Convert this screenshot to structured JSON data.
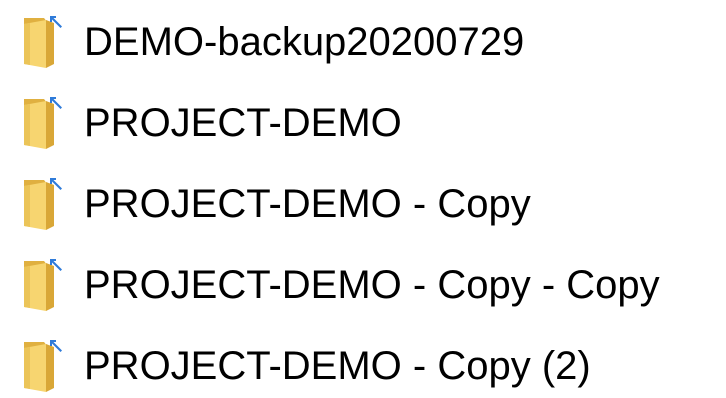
{
  "colors": {
    "folder_back": "#E0B040",
    "folder_front": "#F7D570",
    "folder_front_shade": "#EBC458",
    "shortcut_arrow": "#2F7BD9",
    "text": "#000000"
  },
  "icons": {
    "folder": "folder-shortcut-icon"
  },
  "files": [
    {
      "name": "DEMO-backup20200729"
    },
    {
      "name": "PROJECT-DEMO"
    },
    {
      "name": "PROJECT-DEMO - Copy"
    },
    {
      "name": "PROJECT-DEMO - Copy - Copy"
    },
    {
      "name": "PROJECT-DEMO - Copy (2)"
    }
  ]
}
